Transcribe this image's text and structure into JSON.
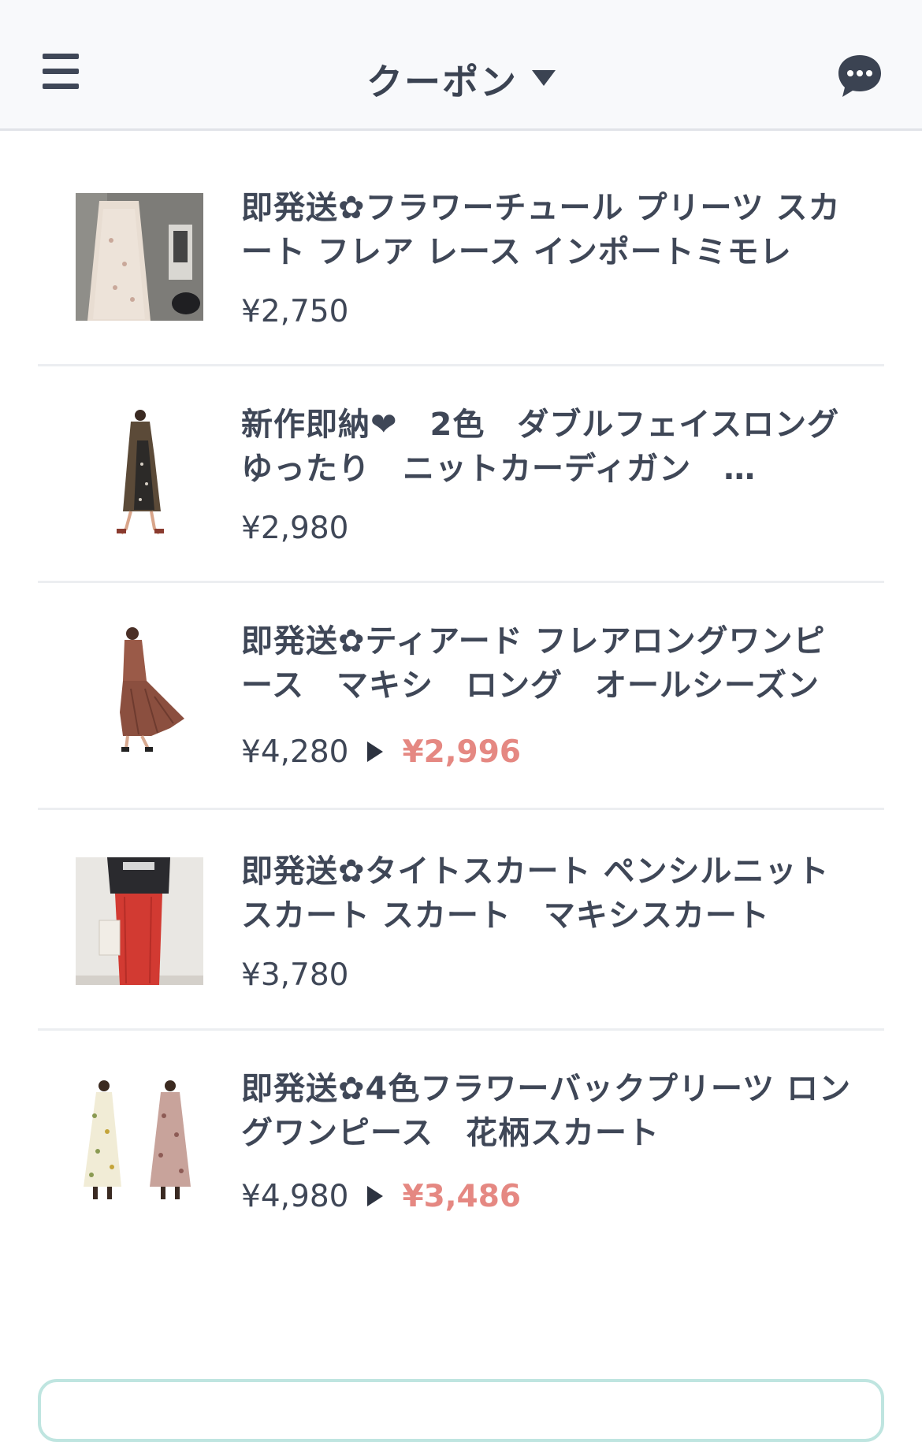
{
  "header": {
    "title": "クーポン",
    "menu_icon": "hamburger-menu-icon",
    "chat_icon": "chat-bubble-icon",
    "dropdown_icon": "caret-down-icon"
  },
  "colors": {
    "text": "#3f4757",
    "sale_price": "#e58882",
    "divider": "#eceef1",
    "header_bg": "#f8f9fb",
    "bottom_button_border": "#bfe5e0"
  },
  "products": [
    {
      "name": "即発送✿フラワーチュール プリーツ スカート フレア レース インポートミモレ",
      "price": "¥2,750",
      "sale_price": null
    },
    {
      "name": "新作即納❤　2色　ダブルフェイスロング　ゆったり　ニットカーディガン　…",
      "price": "¥2,980",
      "sale_price": null
    },
    {
      "name": "即発送✿ティアード フレアロングワンピース　マキシ　ロング　オールシーズン",
      "price": "¥4,280",
      "sale_price": "¥2,996"
    },
    {
      "name": "即発送✿タイトスカート ペンシルニット スカート スカート　マキシスカート",
      "price": "¥3,780",
      "sale_price": null
    },
    {
      "name": "即発送✿4色フラワーバックプリーツ ロングワンピース　花柄スカート",
      "price": "¥4,980",
      "sale_price": "¥3,486"
    }
  ]
}
